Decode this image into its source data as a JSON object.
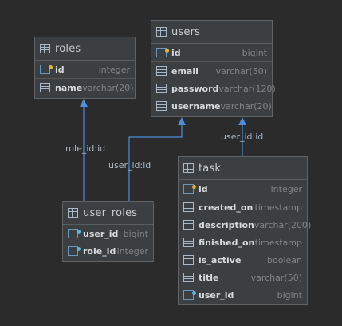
{
  "tables": {
    "roles": {
      "title": "roles",
      "columns": [
        {
          "name": "id",
          "type": "integer",
          "icon": "primary-key-icon"
        },
        {
          "name": "name",
          "type": "varchar(20)",
          "icon": "column-icon"
        }
      ]
    },
    "users": {
      "title": "users",
      "columns": [
        {
          "name": "id",
          "type": "bigint",
          "icon": "primary-key-icon"
        },
        {
          "name": "email",
          "type": "varchar(50)",
          "icon": "column-icon"
        },
        {
          "name": "password",
          "type": "varchar(120)",
          "icon": "column-icon"
        },
        {
          "name": "username",
          "type": "varchar(20)",
          "icon": "column-icon"
        }
      ]
    },
    "user_roles": {
      "title": "user_roles",
      "columns": [
        {
          "name": "user_id",
          "type": "bigint",
          "icon": "foreign-key-icon"
        },
        {
          "name": "role_id",
          "type": "integer",
          "icon": "foreign-key-icon"
        }
      ]
    },
    "task": {
      "title": "task",
      "columns": [
        {
          "name": "id",
          "type": "integer",
          "icon": "primary-key-icon"
        },
        {
          "name": "created_on",
          "type": "timestamp",
          "icon": "column-icon"
        },
        {
          "name": "description",
          "type": "varchar(200)",
          "icon": "column-icon"
        },
        {
          "name": "finished_on",
          "type": "timestamp",
          "icon": "column-icon"
        },
        {
          "name": "is_active",
          "type": "boolean",
          "icon": "column-icon"
        },
        {
          "name": "title",
          "type": "varchar(50)",
          "icon": "column-icon"
        },
        {
          "name": "user_id",
          "type": "bigint",
          "icon": "foreign-key-icon"
        }
      ]
    }
  },
  "relations": {
    "user_roles_to_roles": "role_id:id",
    "user_roles_to_users": "user_id:id",
    "task_to_users": "user_id:id"
  },
  "colors": {
    "background": "#2b2b2b",
    "table_fill": "#3c3f41",
    "relation_line": "#4a8fd8"
  }
}
